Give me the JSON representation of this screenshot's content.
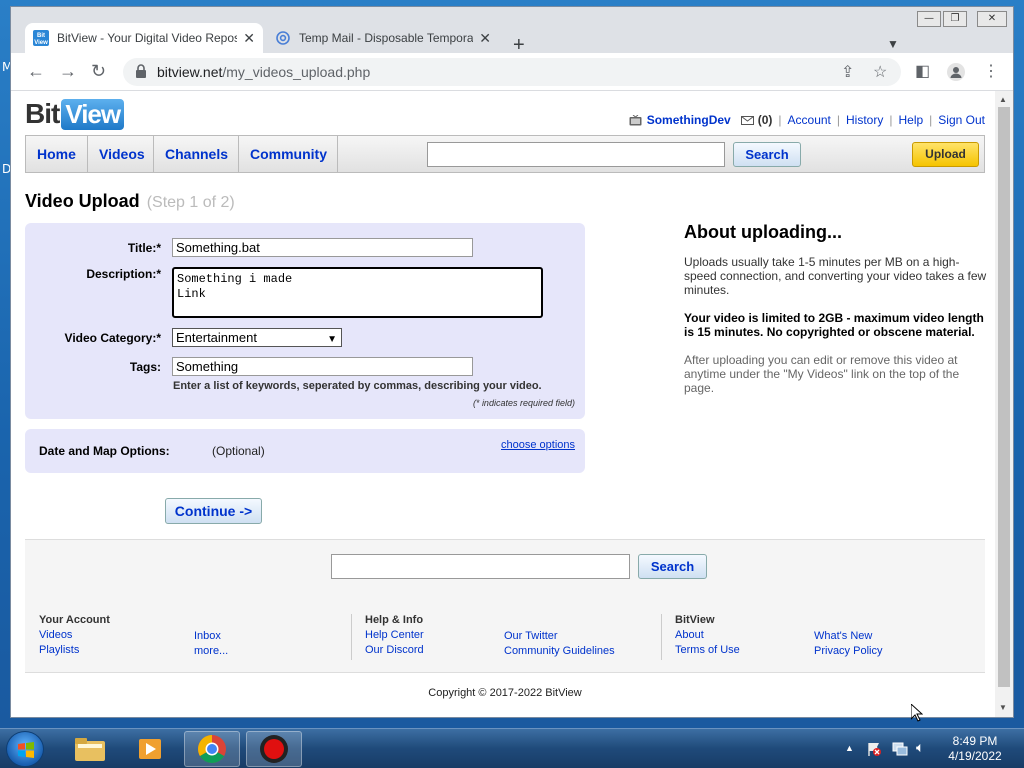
{
  "desktop": {
    "letters": [
      "M",
      "D"
    ]
  },
  "browser": {
    "tabs": [
      {
        "title": "BitView - Your Digital Video Repository",
        "close": "✕"
      },
      {
        "title": "Temp Mail - Disposable Temporary Email",
        "close": "✕"
      }
    ],
    "new_tab": "+",
    "url_domain": "bitview.net",
    "url_path": "/my_videos_upload.php"
  },
  "site": {
    "logo_bit": "Bit",
    "logo_view": "View",
    "userbar": {
      "username": "SomethingDev",
      "messages": "(0)",
      "account": "Account",
      "history": "History",
      "help": "Help",
      "sign_out": "Sign Out"
    },
    "nav": {
      "items": [
        "Home",
        "Videos",
        "Channels",
        "Community"
      ],
      "search_button": "Search",
      "upload_button": "Upload"
    },
    "page_title": "Video Upload",
    "page_step": "(Step 1 of 2)",
    "form": {
      "title_label": "Title:*",
      "title_value": "Something.bat",
      "description_label": "Description:*",
      "description_value": "Something i made\nLink",
      "category_label": "Video Category:*",
      "category_value": "Entertainment",
      "tags_label": "Tags:",
      "tags_value": "Something",
      "tags_hint": "Enter a list of keywords, seperated by commas, describing your video.",
      "required_note": "(* indicates required field)"
    },
    "options": {
      "label": "Date and Map Options:",
      "optional": "(Optional)",
      "link": "choose options"
    },
    "continue_button": "Continue ->",
    "about": {
      "heading": "About uploading...",
      "p1": "Uploads usually take 1-5 minutes per MB on a high-speed connection, and converting your video takes a few minutes.",
      "p2": "Your video is limited to 2GB - maximum video length is 15 minutes. No copyrighted or obscene material.",
      "p3": "After uploading you can edit or remove this video at anytime under the \"My Videos\" link on the top of the page."
    },
    "footer": {
      "search_button": "Search",
      "your_account": {
        "heading": "Your Account",
        "links": [
          "Videos",
          "Playlists",
          "Inbox",
          "more..."
        ]
      },
      "help_info": {
        "heading": "Help & Info",
        "links": [
          "Help Center",
          "Our Discord",
          "Our Twitter",
          "Community Guidelines"
        ]
      },
      "bitview": {
        "heading": "BitView",
        "links": [
          "About",
          "Terms of Use",
          "What's New",
          "Privacy Policy"
        ]
      },
      "copyright": "Copyright © 2017-2022 BitView"
    }
  },
  "taskbar": {
    "time": "8:49 PM",
    "date": "4/19/2022"
  },
  "colors": {
    "link": "#0033cc",
    "form_bg": "#e6e6fa",
    "upload_yellow": "#f5c400"
  }
}
